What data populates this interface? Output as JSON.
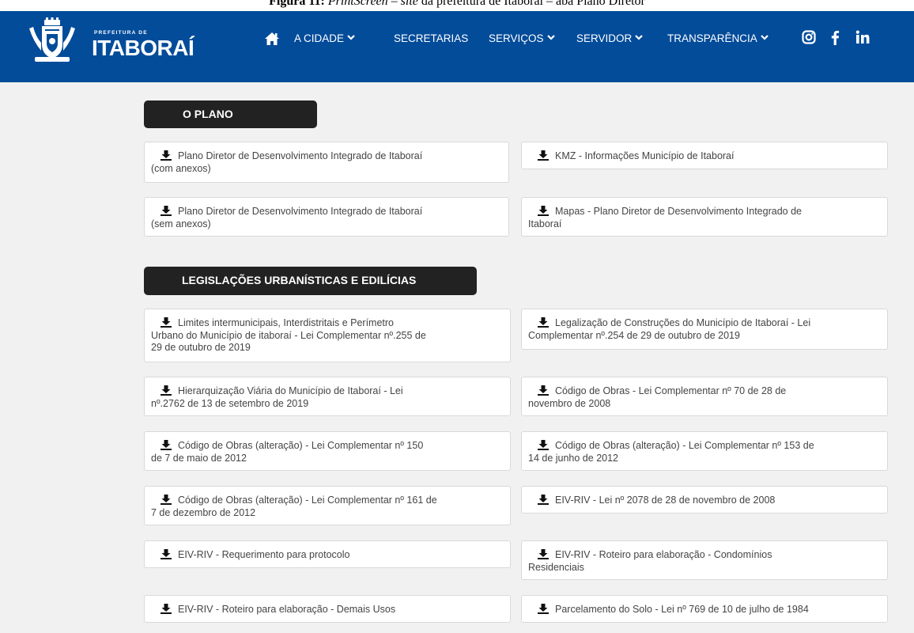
{
  "caption": {
    "prefix": "Figura 11:",
    "italic": "PrintScreen – site",
    "rest": " da prefeitura de Itaboraí – aba Plano Diretor"
  },
  "header": {
    "logo_small": "PREFEITURA DE",
    "logo_big": "ITABORAÍ",
    "home_icon": "home-icon",
    "nav": [
      "A CIDADE",
      "SECRETARIAS",
      "SERVIÇOS",
      "SERVIDOR",
      "TRANSPARÊNCIA"
    ],
    "social_icons": [
      "instagram-icon",
      "facebook-icon",
      "linkedin-icon"
    ],
    "background": "#034c9a"
  },
  "sections": [
    {
      "title": "O PLANO",
      "items": [
        [
          "Plano Diretor de Desenvolvimento Integrado de Itaboraí",
          "(com anexos)"
        ],
        [
          "KMZ - Informações Município de Itaboraí"
        ],
        [
          "Plano Diretor de Desenvolvimento Integrado de Itaboraí",
          "(sem anexos)"
        ],
        [
          "Mapas - Plano Diretor de Desenvolvimento Integrado de",
          "Itaboraí"
        ]
      ]
    },
    {
      "title": "LEGISLAÇÕES URBANÍSTICAS E EDILÍCIAS",
      "items": [
        [
          "Limites intermunicipais, Interdistritais e Perímetro",
          "Urbano do Município de itaboraí - Lei Complementar nº.255 de",
          "29 de outubro de 2019"
        ],
        [
          "Legalização de Construções do Município de Itaboraí - Lei",
          "Complementar nº.254 de 29 de outubro de 2019"
        ],
        [
          "Hierarquização Viária do Município de Itaboraí - Lei",
          "nº.2762 de 13 de setembro de 2019"
        ],
        [
          "Código de Obras - Lei Complementar nº 70 de 28 de",
          "novembro de 2008"
        ],
        [
          "Código de Obras (alteração) - Lei Complementar nº 150",
          "de 7 de maio de 2012"
        ],
        [
          "Código de Obras (alteração) - Lei Complementar nº 153 de",
          "14 de junho de 2012"
        ],
        [
          "Código de Obras (alteração) - Lei Complementar nº 161 de",
          "7 de dezembro de 2012"
        ],
        [
          "EIV-RIV - Lei nº 2078 de 28 de novembro de 2008"
        ],
        [
          "EIV-RIV - Requerimento para protocolo"
        ],
        [
          "EIV-RIV - Roteiro para elaboração - Condomínios",
          "Residenciais"
        ],
        [
          "EIV-RIV - Roteiro para elaboração - Demais Usos"
        ],
        [
          "Parcelamento do Solo - Lei nº 769 de 10 de julho de 1984"
        ]
      ]
    }
  ]
}
